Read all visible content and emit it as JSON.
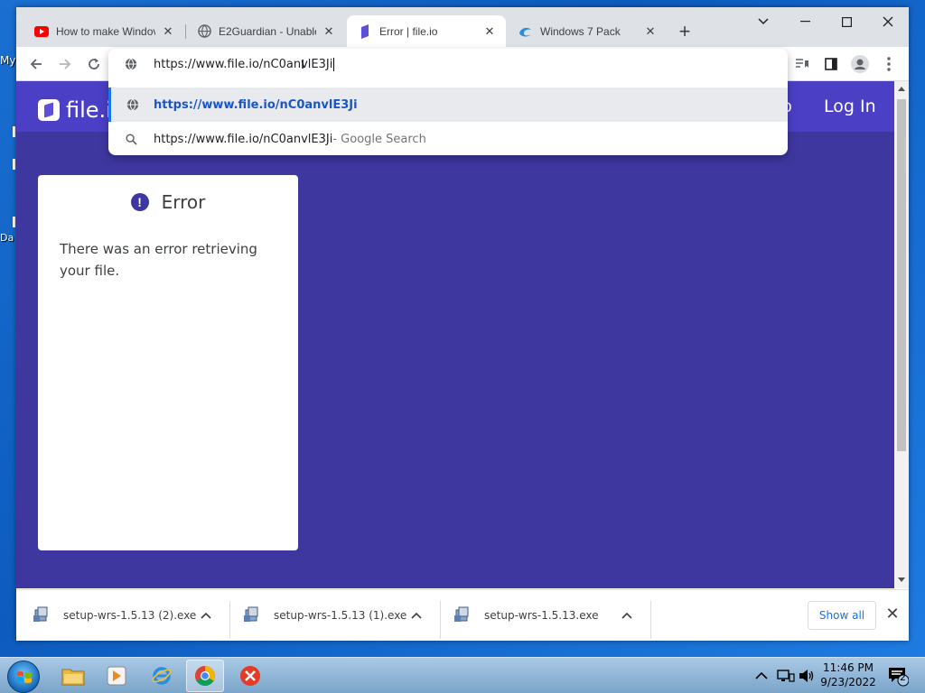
{
  "desktop": {
    "labels": [
      "My",
      "Da"
    ]
  },
  "browser": {
    "tabs": [
      {
        "title": "How to make Windov",
        "icon": "youtube-icon",
        "active": false
      },
      {
        "title": "E2Guardian - Unable",
        "icon": "globe-icon",
        "active": false
      },
      {
        "title": "Error | file.io",
        "icon": "fileio-icon",
        "active": true
      },
      {
        "title": "Windows 7 Pack",
        "icon": "edge-icon",
        "active": false
      }
    ],
    "omnibox": {
      "input_value": "https://www.file.io/nC0anvlE3Ji",
      "suggestions": [
        {
          "text": "https://www.file.io/nC0anvlE3Ji",
          "suffix": "",
          "icon": "globe-icon"
        },
        {
          "text": "https://www.file.io/nC0anvlE3Ji",
          "suffix": " - Google Search",
          "icon": "search-icon"
        }
      ]
    }
  },
  "page": {
    "logo_text": "file.io",
    "header_partial": "o",
    "login_label": "Log In",
    "error": {
      "title": "Error",
      "message": "There was an error retrieving your file."
    },
    "colors": {
      "background": "#3f37a0",
      "header": "#4b3fc6"
    }
  },
  "downloads": {
    "items": [
      {
        "name": "setup-wrs-1.5.13 (2).exe"
      },
      {
        "name": "setup-wrs-1.5.13 (1).exe"
      },
      {
        "name": "setup-wrs-1.5.13.exe"
      }
    ],
    "show_all_label": "Show all"
  },
  "taskbar": {
    "time": "11:46 PM",
    "date": "9/23/2022",
    "notification_count": "2"
  }
}
